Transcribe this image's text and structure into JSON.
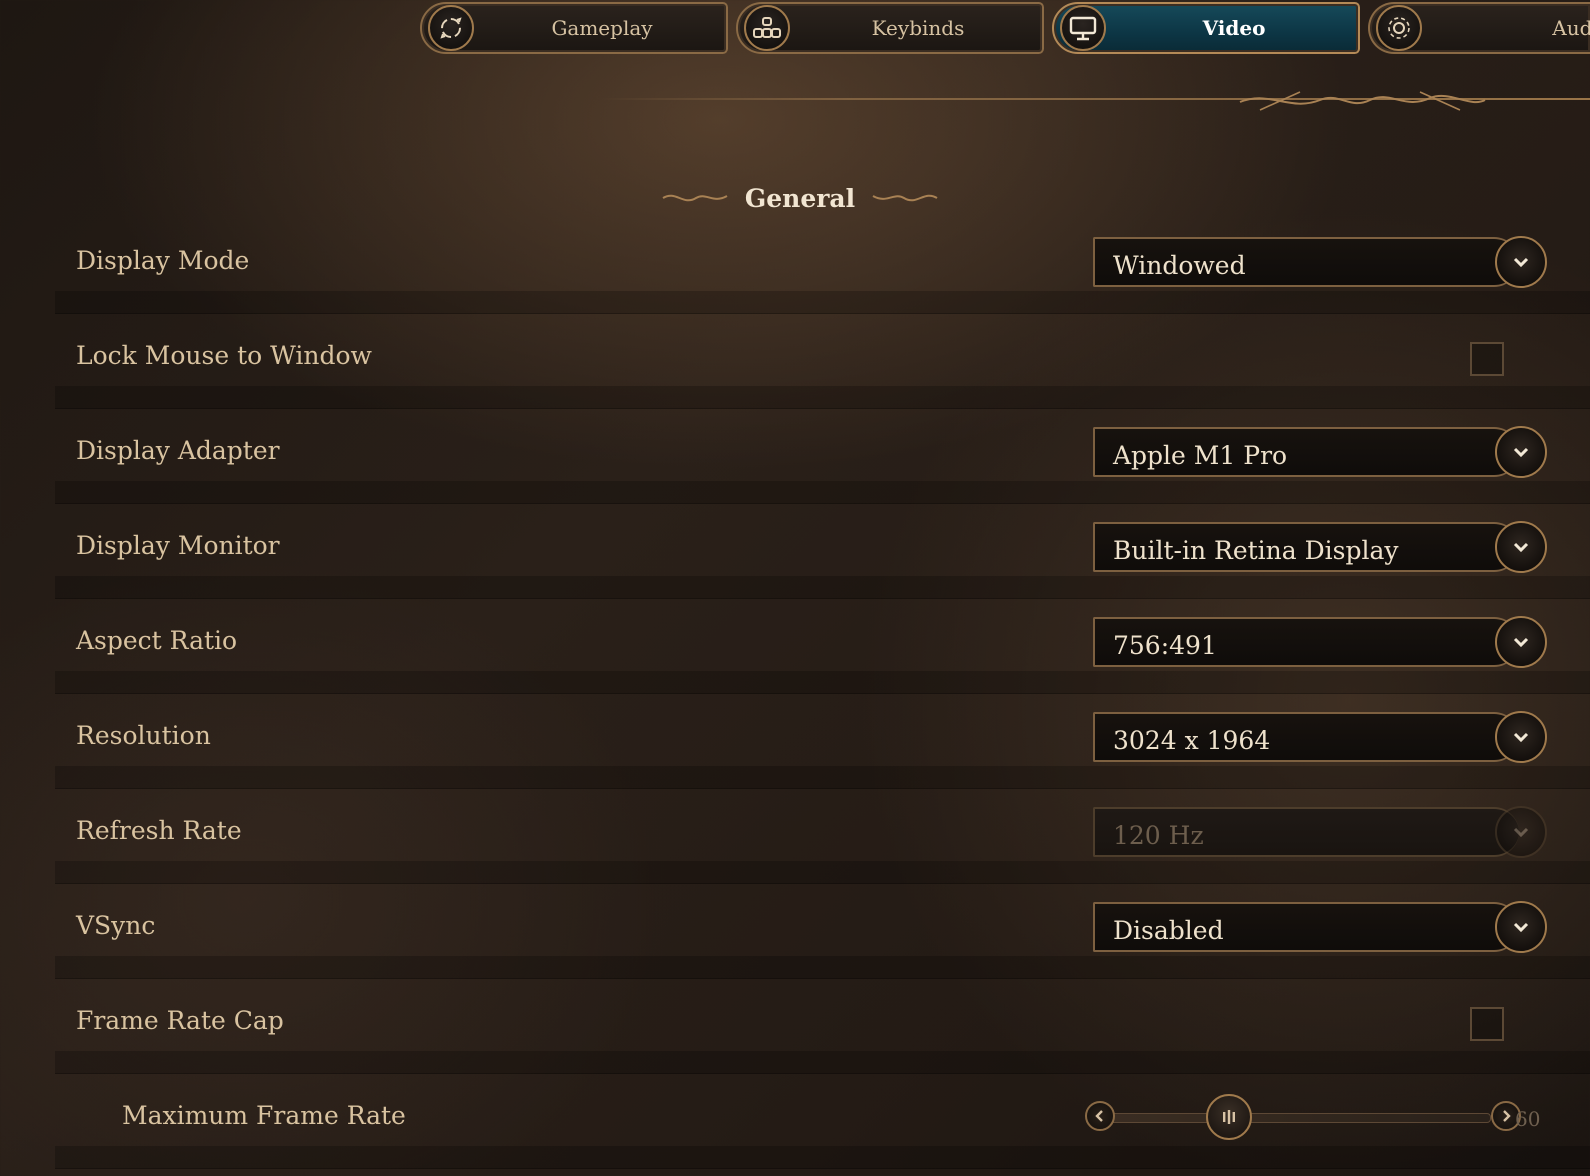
{
  "tabs": [
    {
      "label": "Gameplay",
      "icon": "gameplay-icon",
      "active": false
    },
    {
      "label": "Keybinds",
      "icon": "keybinds-icon",
      "active": false
    },
    {
      "label": "Video",
      "icon": "monitor-icon",
      "active": true
    },
    {
      "label": "Audic",
      "icon": "audio-icon",
      "active": false
    }
  ],
  "section": {
    "title": "General"
  },
  "settings": {
    "display_mode": {
      "label": "Display Mode",
      "value": "Windowed"
    },
    "lock_mouse": {
      "label": "Lock Mouse to Window",
      "checked": false
    },
    "display_adapter": {
      "label": "Display Adapter",
      "value": "Apple M1 Pro"
    },
    "display_monitor": {
      "label": "Display Monitor",
      "value": "Built-in Retina Display"
    },
    "aspect_ratio": {
      "label": "Aspect Ratio",
      "value": "756:491"
    },
    "resolution": {
      "label": "Resolution",
      "value": "3024 x 1964"
    },
    "refresh_rate": {
      "label": "Refresh Rate",
      "value": "120 Hz",
      "disabled": true
    },
    "vsync": {
      "label": "VSync",
      "value": "Disabled"
    },
    "frame_rate_cap": {
      "label": "Frame Rate Cap",
      "checked": false
    },
    "max_frame_rate": {
      "label": "Maximum Frame Rate",
      "value": "60",
      "fraction": 0.3,
      "disabled": true
    }
  },
  "colors": {
    "accent_gold": "#a07a4c",
    "active_tab": "#0d3645",
    "text": "#d9c3a0"
  }
}
